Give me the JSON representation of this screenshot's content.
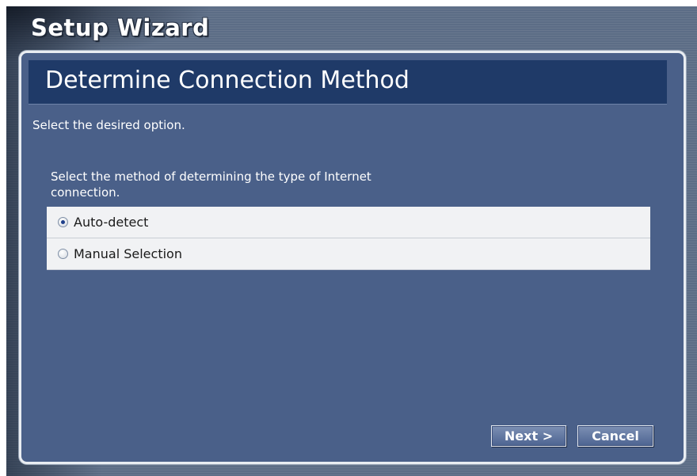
{
  "window": {
    "title": "Setup Wizard"
  },
  "panel": {
    "heading": "Determine Connection Method",
    "subtitle": "Select the desired option.",
    "instructions": "Select the method of determining the type of Internet connection."
  },
  "options": [
    {
      "label": "Auto-detect",
      "selected": true
    },
    {
      "label": "Manual Selection",
      "selected": false
    }
  ],
  "buttons": {
    "next_label": "Next >",
    "cancel_label": "Cancel"
  },
  "colors": {
    "background": "#5c6d86",
    "panel": "#4a6089",
    "header": "#1f3a68",
    "option_row": "#f1f2f4"
  }
}
